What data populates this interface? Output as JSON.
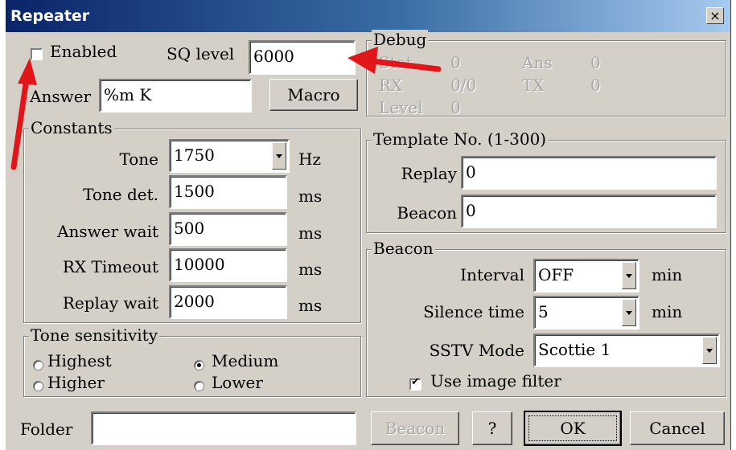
{
  "window": {
    "title": "Repeater",
    "close_glyph": "×"
  },
  "top": {
    "enabled_label": "Enabled",
    "enabled_checked": false,
    "sq_level_label": "SQ level",
    "sq_level_value": "6000",
    "answer_label": "Answer",
    "answer_value": "%m K",
    "macro_label": "Macro"
  },
  "debug": {
    "caption": "Debug",
    "stat_label": "Stat",
    "stat_value": "0",
    "ans_label": "Ans",
    "ans_value": "0",
    "rx_label": "RX",
    "rx_value": "0/0",
    "tx_label": "TX",
    "tx_value": "0",
    "level_label": "Level",
    "level_value": "0"
  },
  "constants": {
    "caption": "Constants",
    "tone_label": "Tone",
    "tone_value": "1750",
    "tone_unit": "Hz",
    "tone_det_label": "Tone det.",
    "tone_det_value": "1500",
    "tone_det_unit": "ms",
    "answer_wait_label": "Answer wait",
    "answer_wait_value": "500",
    "answer_wait_unit": "ms",
    "rx_timeout_label": "RX Timeout",
    "rx_timeout_value": "10000",
    "rx_timeout_unit": "ms",
    "replay_wait_label": "Replay wait",
    "replay_wait_value": "2000",
    "replay_wait_unit": "ms"
  },
  "template": {
    "caption": "Template No. (1-300)",
    "replay_label": "Replay",
    "replay_value": "0",
    "beacon_label": "Beacon",
    "beacon_value": "0"
  },
  "beacon": {
    "caption": "Beacon",
    "interval_label": "Interval",
    "interval_value": "OFF",
    "interval_unit": "min",
    "silence_label": "Silence time",
    "silence_value": "5",
    "silence_unit": "min",
    "sstv_label": "SSTV Mode",
    "sstv_value": "Scottie 1",
    "filter_label": "Use image filter",
    "filter_checked": true
  },
  "sensitivity": {
    "caption": "Tone sensitivity",
    "options": [
      "Highest",
      "Higher",
      "Medium",
      "Lower"
    ],
    "selected": "Medium"
  },
  "bottom": {
    "folder_label": "Folder",
    "folder_value": "",
    "beacon_button": "Beacon",
    "help_button": "?",
    "ok_button": "OK",
    "cancel_button": "Cancel"
  },
  "colors": {
    "annotation_arrow": "#e0161b",
    "title_bar": "#0a246a",
    "dialog_face": "#d4d0c8"
  }
}
